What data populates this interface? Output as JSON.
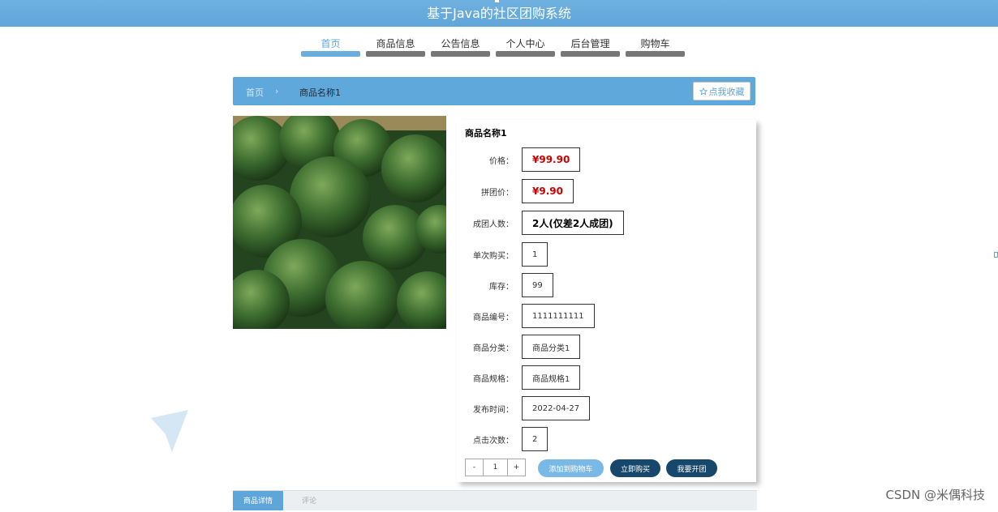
{
  "app": {
    "title": "基于Java的社区团购系统"
  },
  "nav": [
    {
      "label": "首页",
      "active": true
    },
    {
      "label": "商品信息",
      "active": false
    },
    {
      "label": "公告信息",
      "active": false
    },
    {
      "label": "个人中心",
      "active": false
    },
    {
      "label": "后台管理",
      "active": false
    },
    {
      "label": "购物车",
      "active": false
    }
  ],
  "breadcrumb": {
    "home": "首页",
    "separator": "›",
    "current": "商品名称1"
  },
  "favorite": {
    "label": "点我收藏",
    "icon": "star-icon"
  },
  "product": {
    "name": "商品名称1",
    "fields": {
      "price": {
        "label": "价格：",
        "value": "¥99.90"
      },
      "group_price": {
        "label": "拼团价：",
        "value": "¥9.90"
      },
      "group_size": {
        "label": "成团人数：",
        "value": "2人(仅差2人成团)"
      },
      "single_buy": {
        "label": "单次购买：",
        "value": "1"
      },
      "stock": {
        "label": "库存：",
        "value": "99"
      },
      "code": {
        "label": "商品编号：",
        "value": "1111111111"
      },
      "category": {
        "label": "商品分类：",
        "value": "商品分类1"
      },
      "spec": {
        "label": "商品规格：",
        "value": "商品规格1"
      },
      "publish_time": {
        "label": "发布时间：",
        "value": "2022-04-27"
      },
      "clicks": {
        "label": "点击次数：",
        "value": "2"
      }
    }
  },
  "quantity": {
    "minus": "-",
    "value": "1",
    "plus": "+"
  },
  "actions": {
    "add_cart": "添加到购物车",
    "buy_now": "立即购买",
    "start_group": "我要开团"
  },
  "tabs": [
    {
      "label": "商品详情",
      "active": true
    },
    {
      "label": "评论",
      "active": false
    }
  ],
  "watermark": "CSDN @米偶科技",
  "colors": {
    "header": "#5ea6da",
    "price": "#cc0000",
    "dark_button": "#17476a",
    "light_button": "#7ab8e6"
  }
}
